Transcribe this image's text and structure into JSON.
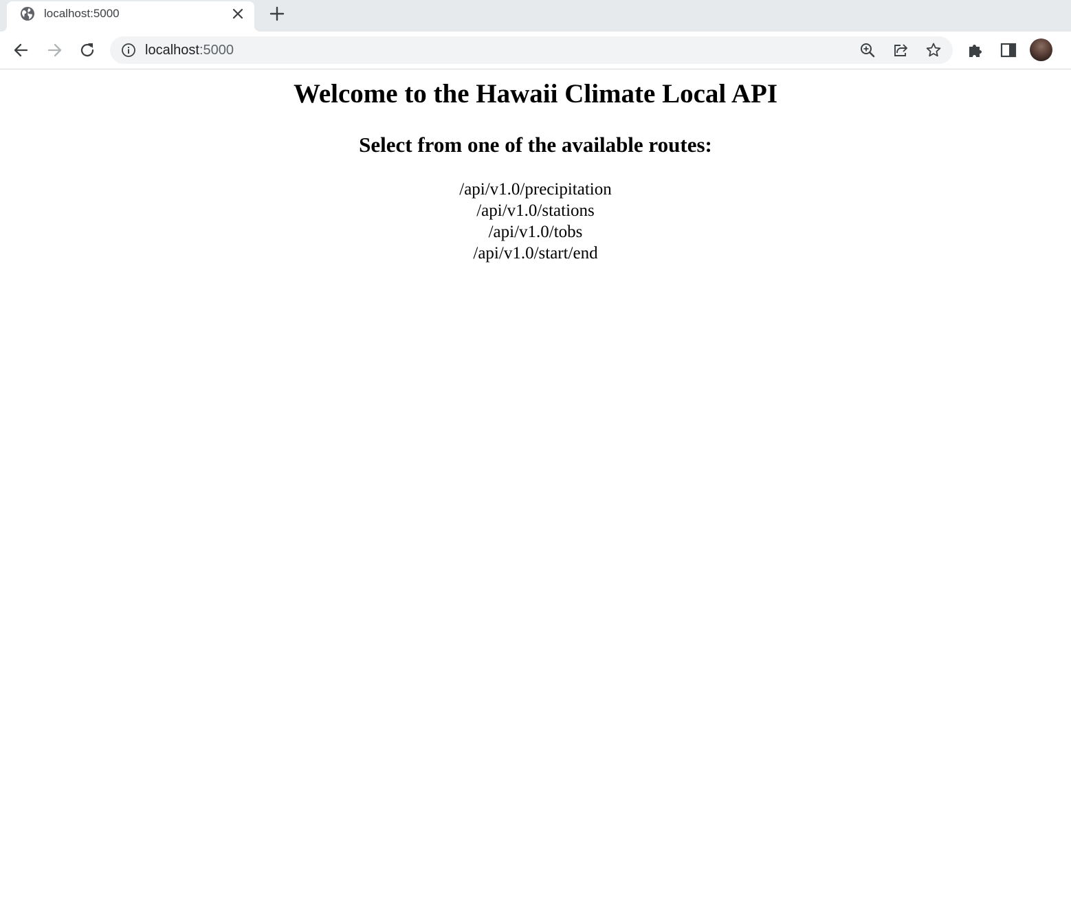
{
  "browser": {
    "tab": {
      "title": "localhost:5000",
      "favicon": "globe-icon",
      "close_icon": "close-icon"
    },
    "new_tab_icon": "plus-icon",
    "toolbar": {
      "back_icon": "arrow-left-icon",
      "forward_icon": "arrow-right-icon",
      "reload_icon": "reload-icon",
      "omnibox": {
        "info_icon": "info-icon",
        "host": "localhost",
        "port": ":5000",
        "zoom_icon": "zoom-in-icon",
        "share_icon": "share-icon",
        "bookmark_icon": "star-icon"
      },
      "extensions_icon": "puzzle-icon",
      "side_panel_icon": "side-panel-icon",
      "avatar": "profile-avatar"
    }
  },
  "page": {
    "title": "Welcome to the Hawaii Climate Local API",
    "subtitle": "Select from one of the available routes:",
    "routes": [
      "/api/v1.0/precipitation",
      "/api/v1.0/stations",
      "/api/v1.0/tobs",
      "/api/v1.0/start/end"
    ]
  },
  "colors": {
    "tabstrip_bg": "#e7eaed",
    "omnibox_bg": "#f1f3f4",
    "icon_gray": "#5f6368",
    "text": "#000000"
  }
}
